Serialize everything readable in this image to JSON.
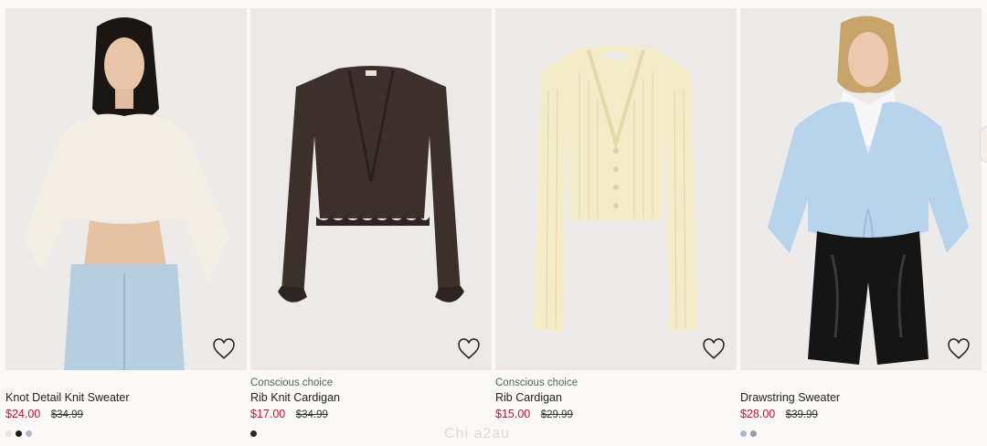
{
  "products": [
    {
      "conscious": "",
      "name": "Knot Detail Knit Sweater",
      "sale_price": "$24.00",
      "original_price": "$34.99",
      "swatches": [
        "#e8e6e2",
        "#1a1a1a",
        "#a9b9d8"
      ],
      "image": "woman-cream-cropped-sweater"
    },
    {
      "conscious": "Conscious choice",
      "name": "Rib Knit Cardigan",
      "sale_price": "$17.00",
      "original_price": "$34.99",
      "swatches": [
        "#2a2522"
      ],
      "image": "dark-brown-cardigan"
    },
    {
      "conscious": "Conscious choice",
      "name": "Rib Cardigan",
      "sale_price": "$15.00",
      "original_price": "$29.99",
      "swatches": [],
      "image": "light-yellow-rib-cardigan"
    },
    {
      "conscious": "",
      "name": "Drawstring Sweater",
      "sale_price": "$28.00",
      "original_price": "$39.99",
      "swatches": [
        "#a9b9d8",
        "#9a9aa0"
      ],
      "image": "woman-light-blue-sweater"
    }
  ],
  "watermark": "Chi  a2au",
  "colors": {
    "sale": "#c8102e",
    "conscious": "#4e6b4f"
  },
  "icons": {
    "favorite": "heart-outline-icon",
    "next": "chevron-right-icon"
  }
}
